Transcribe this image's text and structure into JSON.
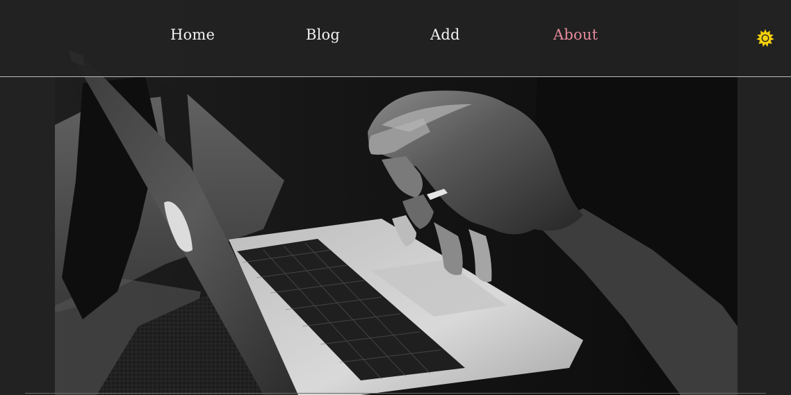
{
  "nav": {
    "items": [
      {
        "label": "Home"
      },
      {
        "label": "Blog"
      },
      {
        "label": "Add"
      },
      {
        "label": "About"
      }
    ],
    "active_item": "About",
    "active_color": "#e58a9b",
    "text_color": "#f2f2f2",
    "background": "#222222"
  },
  "theme_toggle": {
    "icon": "sun-icon",
    "color": "#f5d10a"
  },
  "hero": {
    "image": "laptop-typing-photo",
    "style": "black-and-white"
  }
}
